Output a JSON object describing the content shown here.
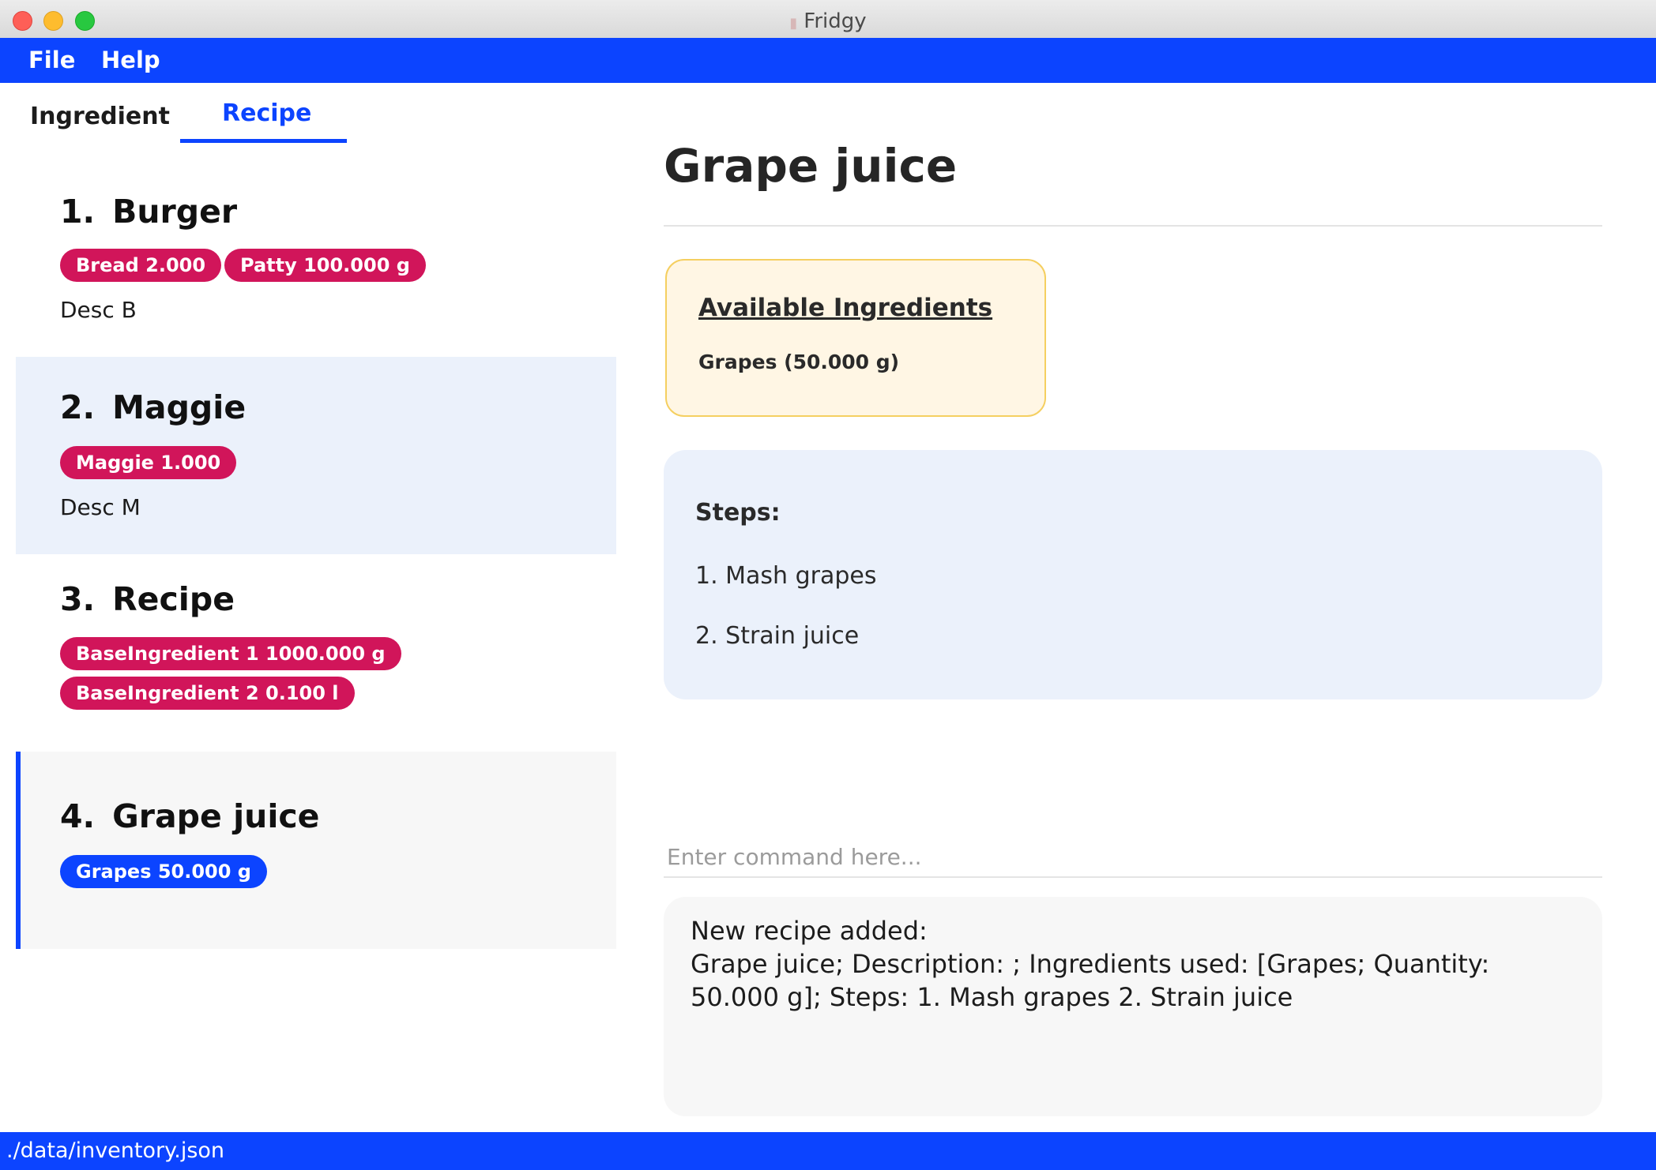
{
  "window": {
    "title": "Fridgy",
    "icon": "fridge-icon",
    "controls": [
      "close",
      "minimize",
      "zoom"
    ]
  },
  "menu": {
    "file": "File",
    "help": "Help"
  },
  "tabs": [
    {
      "label": "Ingredient",
      "active": false
    },
    {
      "label": "Recipe",
      "active": true
    }
  ],
  "recipes": [
    {
      "index": "1.",
      "name": "Burger",
      "ingredients": [
        "Bread 2.000",
        "Patty 100.000 g"
      ],
      "description": "Desc B"
    },
    {
      "index": "2.",
      "name": "Maggie",
      "ingredients": [
        "Maggie 1.000"
      ],
      "description": "Desc M"
    },
    {
      "index": "3.",
      "name": "Recipe",
      "ingredients": [
        "BaseIngredient 1 1000.000 g",
        "BaseIngredient 2 0.100 l"
      ],
      "description": ""
    },
    {
      "index": "4.",
      "name": "Grape juice",
      "ingredients": [
        "Grapes 50.000 g"
      ],
      "description": ""
    }
  ],
  "detail": {
    "title": "Grape juice",
    "available_heading": "Available Ingredients",
    "available_items": [
      "Grapes (50.000 g)"
    ],
    "steps_heading": "Steps:",
    "steps": [
      "1. Mash grapes",
      "2. Strain juice"
    ]
  },
  "command": {
    "placeholder": "Enter command here...",
    "value": ""
  },
  "result": {
    "text": "New recipe added:\nGrape juice; Description: ; Ingredients used: [Grapes; Quantity: 50.000 g]; Steps: 1. Mash grapes 2. Strain juice"
  },
  "status": {
    "path": "./data/inventory.json"
  },
  "colors": {
    "accent": "#0c44ff",
    "chip": "#d1155a",
    "selected_chip": "#0c44ff",
    "alt_row": "#ebf1fb",
    "available_box": "#fff6e4"
  }
}
